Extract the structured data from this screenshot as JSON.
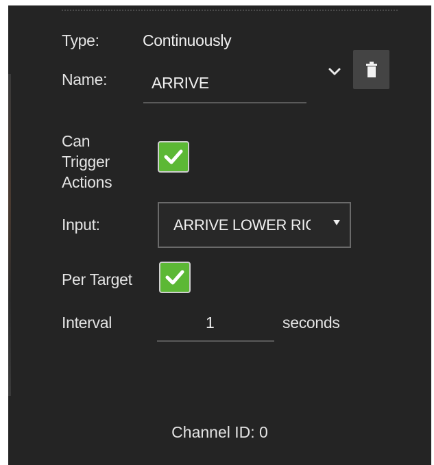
{
  "fields": {
    "type_label": "Type:",
    "type_value": "Continuously",
    "name_label": "Name:",
    "name_value": "ARRIVE",
    "can_trigger_line1": "Can",
    "can_trigger_line2": "Trigger",
    "can_trigger_line3": "Actions",
    "can_trigger_checked": true,
    "input_label": "Input:",
    "input_selected": "ARRIVE LOWER RIGHT",
    "per_target_label": "Per Target",
    "per_target_checked": true,
    "interval_label": "Interval",
    "interval_value": "1",
    "interval_unit": "seconds"
  },
  "footer": {
    "channel_id": "Channel ID: 0"
  },
  "icons": {
    "expand": "chevron-down-icon",
    "delete": "trash-icon",
    "check": "check-icon",
    "dropdown": "caret-down-icon"
  },
  "colors": {
    "panel_bg": "#242424",
    "checkbox_green": "#5cb835",
    "button_bg": "#444444"
  }
}
